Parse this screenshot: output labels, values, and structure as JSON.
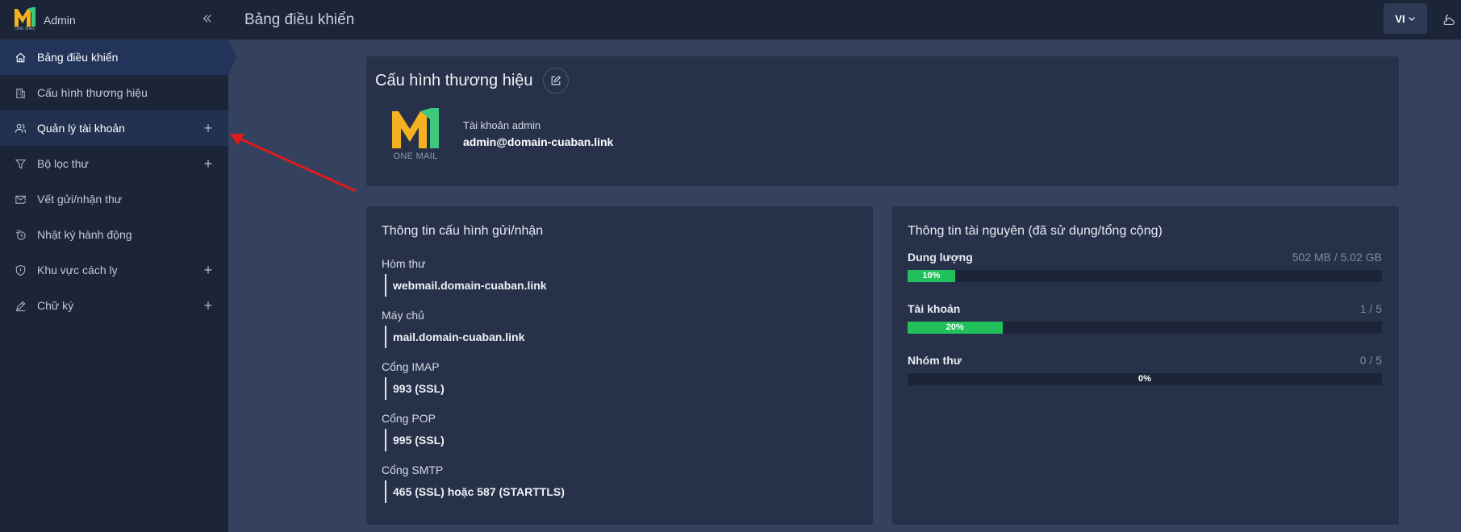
{
  "app": {
    "name": "Admin",
    "logo_tiny_text": "ONE MAIL"
  },
  "sidebar": {
    "items": [
      {
        "label": "Bảng điều khiển"
      },
      {
        "label": "Cấu hình thương hiệu"
      },
      {
        "label": "Quản lý tài khoản"
      },
      {
        "label": "Bộ lọc thư"
      },
      {
        "label": "Vết gửi/nhận thư"
      },
      {
        "label": "Nhật ký hành động"
      },
      {
        "label": "Khu vực cách ly"
      },
      {
        "label": "Chữ ký"
      }
    ]
  },
  "header": {
    "title": "Bảng điều khiển",
    "language": "VI"
  },
  "brand_card": {
    "title": "Cấu hình thương hiệu",
    "logo_caption": "ONE MAIL",
    "admin_label": "Tài khoản admin",
    "admin_email": "admin@domain-cuaban.link"
  },
  "config_card": {
    "title": "Thông tin cấu hình gửi/nhận",
    "items": [
      {
        "label": "Hòm thư",
        "value": "webmail.domain-cuaban.link"
      },
      {
        "label": "Máy chủ",
        "value": "mail.domain-cuaban.link"
      },
      {
        "label": "Cổng IMAP",
        "value": "993 (SSL)"
      },
      {
        "label": "Cổng POP",
        "value": "995 (SSL)"
      },
      {
        "label": "Cổng SMTP",
        "value": "465 (SSL) hoặc 587 (STARTTLS)"
      }
    ]
  },
  "resource_card": {
    "title": "Thông tin tài nguyên (đã sử dụng/tổng cộng)",
    "items": [
      {
        "label": "Dung lượng",
        "usage": "502 MB / 5.02 GB",
        "percent": 10,
        "percent_label": "10%"
      },
      {
        "label": "Tài khoản",
        "usage": "1 / 5",
        "percent": 20,
        "percent_label": "20%"
      },
      {
        "label": "Nhóm thư",
        "usage": "0 / 5",
        "percent": 0,
        "percent_label": "0%"
      }
    ]
  },
  "colors": {
    "sidebar_bg": "#1b2537",
    "content_bg": "#34415f",
    "card_bg": "#27324a",
    "progress_fill": "#21c05b",
    "logo_yellow": "#f5b220",
    "logo_green": "#3dc87e",
    "annotation_arrow": "#e01b1b"
  },
  "icons": {
    "collapse": "double-chevron-left-icon",
    "nav": [
      "home-icon",
      "building-icon",
      "users-icon",
      "filter-icon",
      "mail-check-icon",
      "activity-log-icon",
      "shield-icon",
      "signature-pen-icon"
    ],
    "edit": "edit-icon",
    "theme": "moon-cloud-icon"
  }
}
